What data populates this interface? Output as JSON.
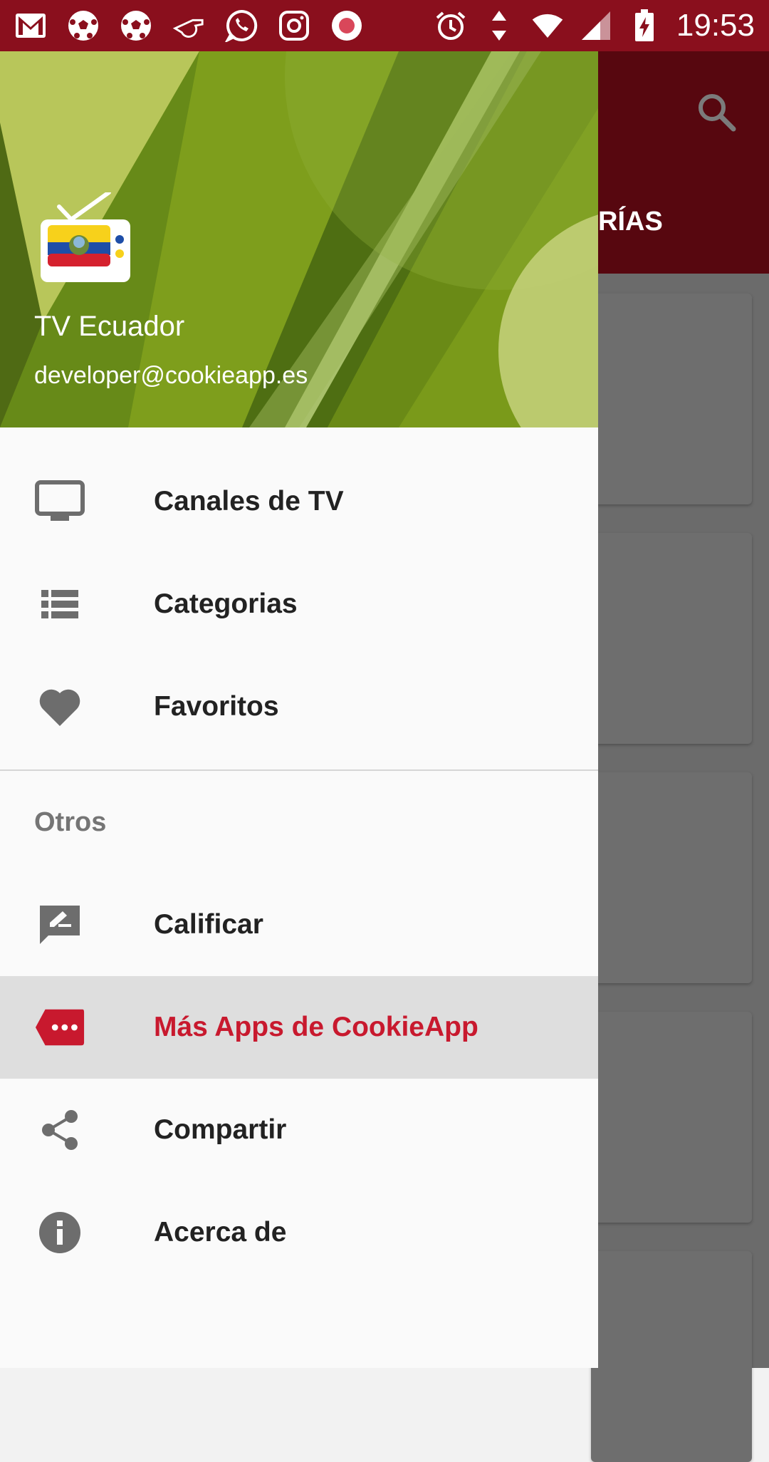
{
  "status_bar": {
    "time": "19:53",
    "left_icons": [
      "gmail-icon",
      "soccer-ball-icon",
      "soccer-ball-icon",
      "whistle-icon",
      "whatsapp-icon",
      "instagram-icon",
      "record-icon"
    ],
    "right_icons": [
      "alarm-icon",
      "data-arrows-icon",
      "wifi-icon",
      "signal-icon",
      "battery-charging-icon"
    ]
  },
  "background_app": {
    "tab_partial": "RÍAS"
  },
  "drawer": {
    "app_name": "TV Ecuador",
    "email": "developer@cookieapp.es",
    "main_items": [
      {
        "label": "Canales de TV",
        "icon": "tv-icon"
      },
      {
        "label": "Categorias",
        "icon": "list-icon"
      },
      {
        "label": "Favoritos",
        "icon": "heart-icon"
      }
    ],
    "section_title": "Otros",
    "other_items": [
      {
        "label": "Calificar",
        "icon": "rate-review-icon"
      },
      {
        "label": "Más Apps de CookieApp",
        "icon": "more-tag-icon",
        "selected": true
      },
      {
        "label": "Compartir",
        "icon": "share-icon"
      },
      {
        "label": "Acerca de",
        "icon": "info-icon"
      }
    ]
  },
  "colors": {
    "status_bar": "#8a0f1d",
    "accent": "#c8192e",
    "header_green": "#6d8a14"
  }
}
